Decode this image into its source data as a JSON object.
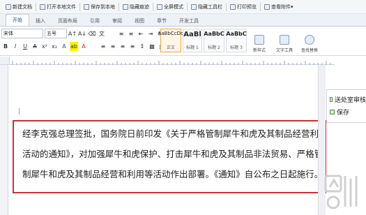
{
  "quickbar": {
    "items": [
      "新建文档",
      "打开本地文件",
      "保存到本地",
      "隐藏痕迹",
      "全屏模式",
      "隐藏工具栏",
      "打印预览",
      "查看附件"
    ]
  },
  "tabs": [
    "开始",
    "插入",
    "页面布局",
    "引用",
    "审阅",
    "视图",
    "章节",
    "开发工具"
  ],
  "ribbon": {
    "font_name": "宋体",
    "font_size": "五号",
    "styles": [
      {
        "sample": "AaBbCcDd",
        "name": "正文"
      },
      {
        "sample": "AaBl",
        "name": "标题 1"
      },
      {
        "sample": "AaBbC",
        "name": "标题 2"
      },
      {
        "sample": "AaBbC",
        "name": "标题 3"
      }
    ],
    "new_style_label": "新样式",
    "text_tool_label": "文字工具",
    "find_replace_label": "查找替换"
  },
  "document": {
    "lines": [
      "经李克强总理签批，国务院日前印发《关于严格管制犀牛和虎及其制品经营利用",
      "活动的通知》，对加强犀牛和虎保护、打击犀牛和虎及其制品非法贸易、严格管",
      "制犀牛和虎及其制品经营和利用等活动作出部署。《通知》自公布之日起施行。"
    ]
  },
  "sidepanel": {
    "items": [
      "送处室审核",
      "保存"
    ]
  },
  "colors": {
    "accent": "#1a4f9c",
    "highlight_frame": "#c83232"
  }
}
